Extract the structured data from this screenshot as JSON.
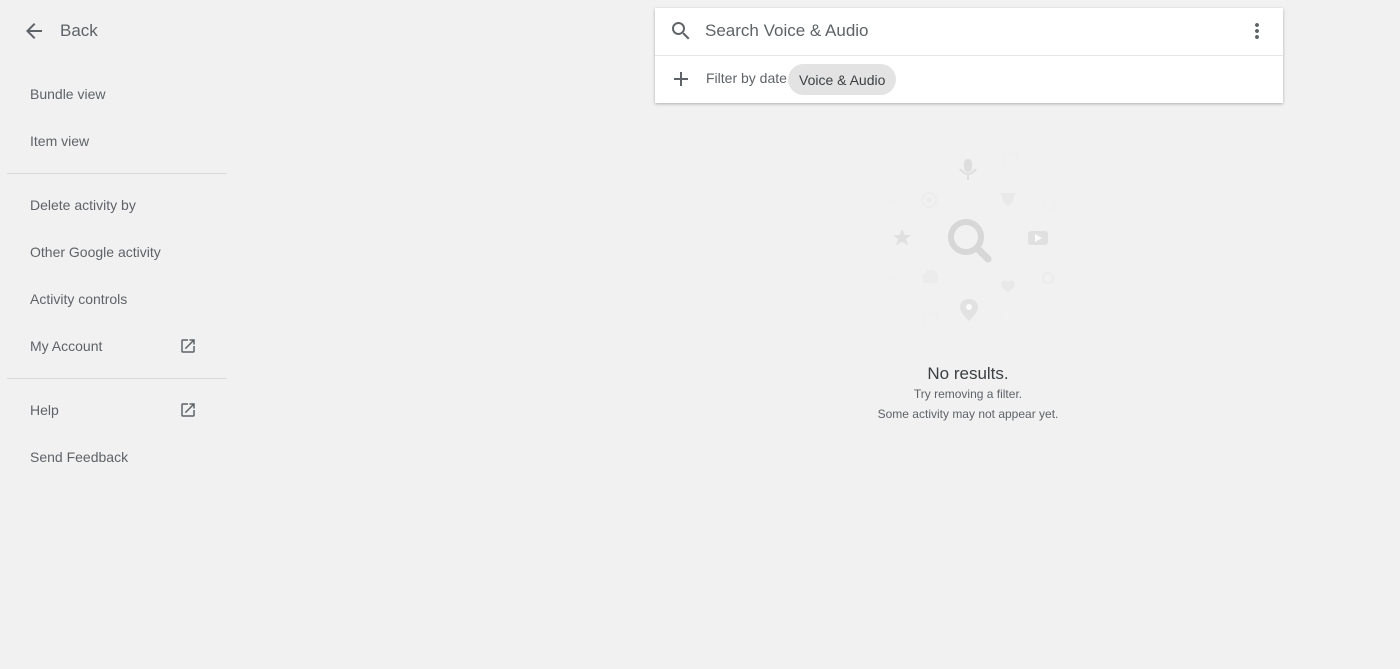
{
  "sidebar": {
    "back_label": "Back",
    "items": [
      {
        "label": "Bundle view"
      },
      {
        "label": "Item view"
      },
      {
        "label": "Delete activity by"
      },
      {
        "label": "Other Google activity"
      },
      {
        "label": "Activity controls"
      },
      {
        "label": "My Account",
        "icon": "open-in-new-icon"
      },
      {
        "label": "Help",
        "icon": "open-in-new-icon"
      },
      {
        "label": "Send Feedback"
      }
    ]
  },
  "search": {
    "placeholder": "Search Voice & Audio",
    "value": "",
    "filter_date_label": "Filter by date",
    "chip_label": "Voice & Audio"
  },
  "empty_state": {
    "title": "No results.",
    "line1": "Try removing a filter.",
    "line2": "Some activity may not appear yet."
  },
  "colors": {
    "background": "#f1f1f1",
    "card": "#ffffff",
    "chip": "#e3e3e3",
    "text_secondary": "#5f6368"
  }
}
